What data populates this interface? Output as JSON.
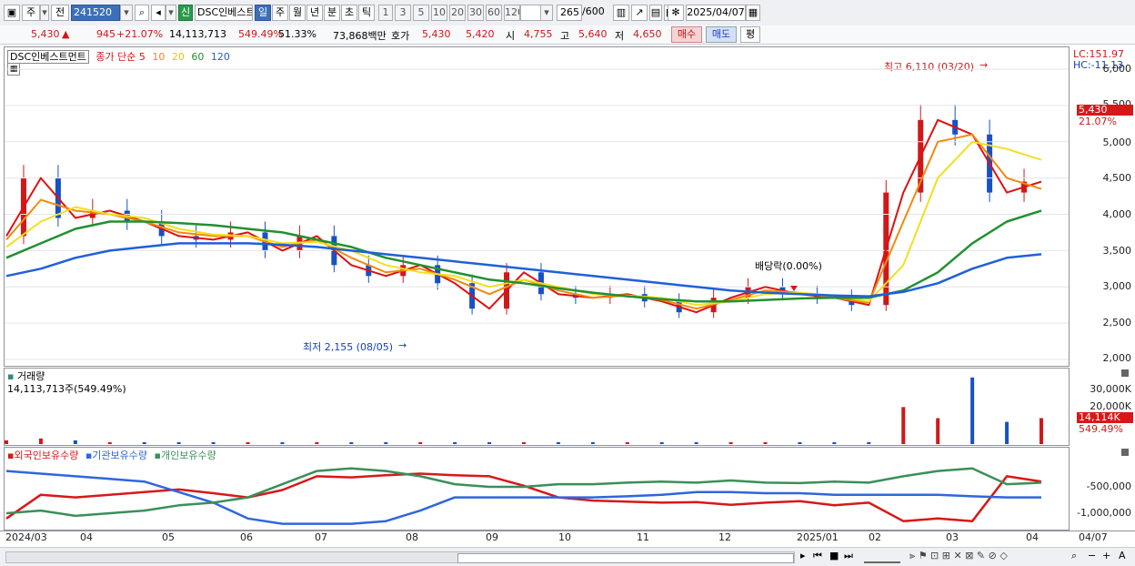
{
  "toolbar": {
    "period": "주",
    "prev": "전",
    "code": "241520",
    "name": "DSC인베스트",
    "new_badge": "신",
    "periods": [
      "일",
      "주",
      "월",
      "년",
      "분",
      "초",
      "틱"
    ],
    "intervals": [
      "1",
      "3",
      "5",
      "10",
      "20",
      "30",
      "60",
      "120"
    ],
    "count": "265",
    "count_max": "/600",
    "date": "2025/04/07"
  },
  "info": {
    "price": "5,430",
    "change": "945",
    "change_pct": "+21.07%",
    "volume": "14,113,713",
    "volume_pct": "549.49%",
    "ratio": "51.33%",
    "amount": "73,868백만",
    "quote_label": "호가",
    "ask": "5,430",
    "bid": "5,420",
    "open_label": "시",
    "open": "4,755",
    "high_label": "고",
    "high": "5,640",
    "low_label": "저",
    "low": "4,650",
    "buy": "매수",
    "sell": "매도",
    "eval": "평"
  },
  "price_panel": {
    "name": "DSC인베스트먼트",
    "ma_title": "종가 단순",
    "ma_periods": [
      "5",
      "10",
      "20",
      "60",
      "120"
    ],
    "lc": "LC:151.97",
    "hc": "HC:-11.13",
    "high_note": "최고 6,110 (03/20)",
    "low_note": "최저 2,155 (08/05)",
    "div_note": "배당락(0.00%)",
    "y_ticks": [
      "6,000",
      "5,500",
      "5,000",
      "4,500",
      "4,000",
      "3,500",
      "3,000",
      "2,500",
      "2,000"
    ],
    "cur_price": "5,430",
    "cur_pct": "21.07%"
  },
  "volume_panel": {
    "title": "거래량",
    "value": "14,113,713주(549.49%)",
    "y_ticks": [
      "30,000K",
      "20,000K"
    ],
    "cur_vol": "14,114K",
    "cur_pct": "549.49%"
  },
  "holders_panel": {
    "legend": [
      "외국인보유수량",
      "기관보유수량",
      "개인보유수량"
    ],
    "y_ticks": [
      "-500,000",
      "-1,000,000"
    ]
  },
  "x_labels": [
    "2024/03",
    "04",
    "05",
    "06",
    "07",
    "08",
    "09",
    "10",
    "11",
    "12",
    "2025/01",
    "02",
    "03",
    "04"
  ],
  "x_right": "04/07",
  "colors": {
    "up": "#d01818",
    "down": "#1850c8",
    "ma5": "#e01010",
    "ma10": "#f08a10",
    "ma20": "#f0e020",
    "ma60": "#229030",
    "ma120": "#2060d8",
    "foreign": "#d81818",
    "inst": "#2f66dd",
    "indiv": "#3a8f5a"
  },
  "chart_data": [
    {
      "type": "line",
      "title": "DSC인베스트먼트",
      "series": [
        {
          "name": "5",
          "values": [
            3700,
            4500,
            3950,
            4050,
            3900,
            3700,
            3650,
            3750,
            3500,
            3700,
            3300,
            3150,
            3300,
            3050,
            2700,
            3200,
            2900,
            2850,
            2900,
            2800,
            2650,
            2850,
            3000,
            2900,
            2850,
            2750,
            4300,
            5300,
            5100,
            4300,
            4450
          ]
        },
        {
          "name": "10",
          "values": [
            3650,
            4200,
            4050,
            4000,
            3900,
            3750,
            3700,
            3700,
            3550,
            3650,
            3400,
            3200,
            3250,
            3100,
            2900,
            3100,
            2950,
            2850,
            2880,
            2820,
            2700,
            2820,
            2950,
            2920,
            2850,
            2780,
            3900,
            5000,
            5100,
            4500,
            4350
          ]
        },
        {
          "name": "20",
          "values": [
            3550,
            3900,
            4100,
            4000,
            3950,
            3800,
            3720,
            3700,
            3600,
            3620,
            3500,
            3300,
            3200,
            3150,
            3000,
            3100,
            3000,
            2900,
            2880,
            2850,
            2750,
            2800,
            2900,
            2920,
            2880,
            2800,
            3300,
            4500,
            5000,
            4900,
            4750
          ]
        },
        {
          "name": "60",
          "values": [
            3400,
            3600,
            3800,
            3900,
            3900,
            3880,
            3850,
            3800,
            3750,
            3650,
            3550,
            3400,
            3300,
            3200,
            3100,
            3050,
            2980,
            2920,
            2870,
            2830,
            2800,
            2800,
            2820,
            2840,
            2850,
            2850,
            2950,
            3200,
            3600,
            3900,
            4050
          ]
        },
        {
          "name": "120",
          "values": [
            3150,
            3250,
            3400,
            3500,
            3550,
            3600,
            3600,
            3600,
            3580,
            3550,
            3500,
            3450,
            3400,
            3350,
            3300,
            3250,
            3200,
            3150,
            3100,
            3050,
            3000,
            2950,
            2920,
            2900,
            2880,
            2870,
            2930,
            3050,
            3250,
            3400,
            3450
          ]
        }
      ]
    },
    {
      "type": "bar",
      "title": "거래량",
      "values": [
        2,
        3,
        2,
        1,
        1,
        1,
        1,
        1,
        1,
        1,
        1,
        1,
        1,
        1,
        1,
        1,
        1,
        1,
        1,
        1,
        1,
        1,
        1,
        1,
        1,
        1,
        20,
        14,
        36,
        12,
        14
      ]
    },
    {
      "type": "line",
      "series": [
        {
          "name": "외국인보유수량",
          "values": [
            -1100000,
            -650000,
            -700000,
            -650000,
            -600000,
            -550000,
            -620000,
            -700000,
            -560000,
            -300000,
            -320000,
            -280000,
            -250000,
            -280000,
            -300000,
            -480000,
            -700000,
            -760000,
            -780000,
            -800000,
            -790000,
            -840000,
            -800000,
            -770000,
            -850000,
            -800000,
            -1150000,
            -1100000,
            -1150000,
            -300000,
            -400000
          ]
        },
        {
          "name": "기관보유수량",
          "values": [
            -200000,
            -250000,
            -300000,
            -350000,
            -400000,
            -600000,
            -800000,
            -1100000,
            -1200000,
            -1200000,
            -1200000,
            -1150000,
            -950000,
            -700000,
            -700000,
            -700000,
            -700000,
            -700000,
            -680000,
            -650000,
            -600000,
            -600000,
            -620000,
            -620000,
            -650000,
            -650000,
            -650000,
            -650000,
            -680000,
            -700000,
            -700000
          ]
        },
        {
          "name": "개인보유수량",
          "values": [
            -1000000,
            -950000,
            -1050000,
            -1000000,
            -950000,
            -850000,
            -800000,
            -700000,
            -450000,
            -200000,
            -150000,
            -200000,
            -300000,
            -450000,
            -500000,
            -500000,
            -450000,
            -450000,
            -420000,
            -400000,
            -420000,
            -380000,
            -420000,
            -430000,
            -400000,
            -420000,
            -300000,
            -200000,
            -150000,
            -450000,
            -420000
          ]
        }
      ]
    }
  ]
}
